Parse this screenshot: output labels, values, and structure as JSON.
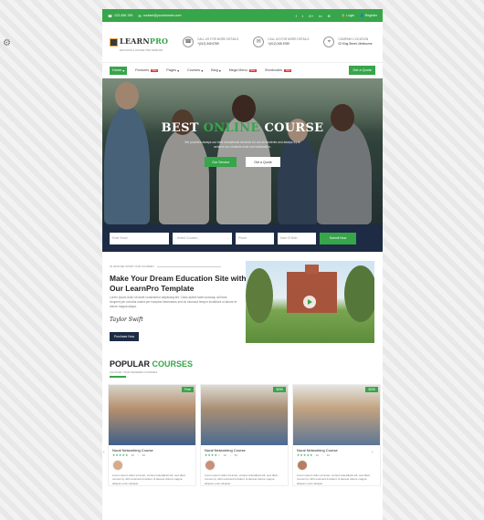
{
  "topbar": {
    "phone": "123-456-789",
    "email": "contact@yourdomain.com",
    "social": [
      "f",
      "t",
      "G+",
      "in",
      "⊕"
    ],
    "login": "Login",
    "register": "Register"
  },
  "header": {
    "logo_main": "LEARN",
    "logo_accent": "PRO",
    "logo_tag": "EDUCATION & COURSE HTML TEMPLATE",
    "contacts": [
      {
        "label": "CALL US FOR MORE DETAILS",
        "value": "+(012) 345 6789"
      },
      {
        "label": "CALL US FOR MORE DETAILS",
        "value": "+(012) 345 6789"
      },
      {
        "label": "COMPANY LOCATION",
        "value": "02 King Street, Melbourne"
      }
    ]
  },
  "nav": {
    "items": [
      "Home",
      "Features",
      "Pages",
      "Courses",
      "Blog",
      "Mega Menu",
      "Shortcodes"
    ],
    "badge_new": "New",
    "cta": "Get a Quote"
  },
  "hero": {
    "title_a": "BEST",
    "title_b": "ONLINE",
    "title_c": "COURSE",
    "text": "We provides always our best educational services for our all students and always try to achieve our students trust and satisfaction.",
    "btn_service": "Our Service",
    "btn_quote": "Get a Quote"
  },
  "search": {
    "email_placeholder": "Enter Email",
    "courses_placeholder": "--Select Courses--",
    "phone_placeholder": "Phone",
    "date_placeholder": "Date Of Birth",
    "submit": "Submit Now"
  },
  "about": {
    "kicker": "IN 2018 WE START OUR JOURNEY",
    "heading": "Make Your Dream Education Site with Our LearnPro Template",
    "desc": "Lorem ipsum dolor sit amet consectetur adipiscing elit. Class aptent taciti sociosqu ad litora torquent per conubia nostra per inceptos himenaeos sed do eiusmod tempor incididunt ut labore et dolore magna aliqua.",
    "signature": "Taylor Swift",
    "button": "Purchase Now"
  },
  "popular": {
    "title_a": "POPULAR",
    "title_b": "COURSES",
    "subtitle": "CHOOSE YOUR DESIRED COURSES",
    "cards": [
      {
        "price": "Free",
        "title": "Nural Networking Course",
        "rating": "(3)",
        "stars": "★★★★★",
        "reviews": "20",
        "likes": "66",
        "text": "Lorem ipsum dolor sit amet, consec tetuadipisl elit, sed diam nonummy nibh euismod tincidunt ut laoreet dolore magna aliquam erat volutpat."
      },
      {
        "price": "$290",
        "title": "Nural Networking Course",
        "rating": "(3)",
        "stars": "★★★★☆",
        "reviews": "20",
        "likes": "66",
        "text": "Lorem ipsum dolor sit amet, consec tetuadipisl elit, sed diam nonummy nibh euismod tincidunt ut laoreet dolore magna aliquam erat volutpat."
      },
      {
        "price": "$290",
        "title": "Nural Networking Course",
        "rating": "(3)",
        "stars": "★★★★★",
        "reviews": "20",
        "likes": "66",
        "text": "Lorem ipsum dolor sit amet, consec tetuadipisl elit, sed diam nonummy nibh euismod tincidunt ut laoreet dolore magna aliquam erat volutpat."
      }
    ]
  },
  "colors": {
    "accent": "#37a54a",
    "navy": "#1d2b44"
  }
}
